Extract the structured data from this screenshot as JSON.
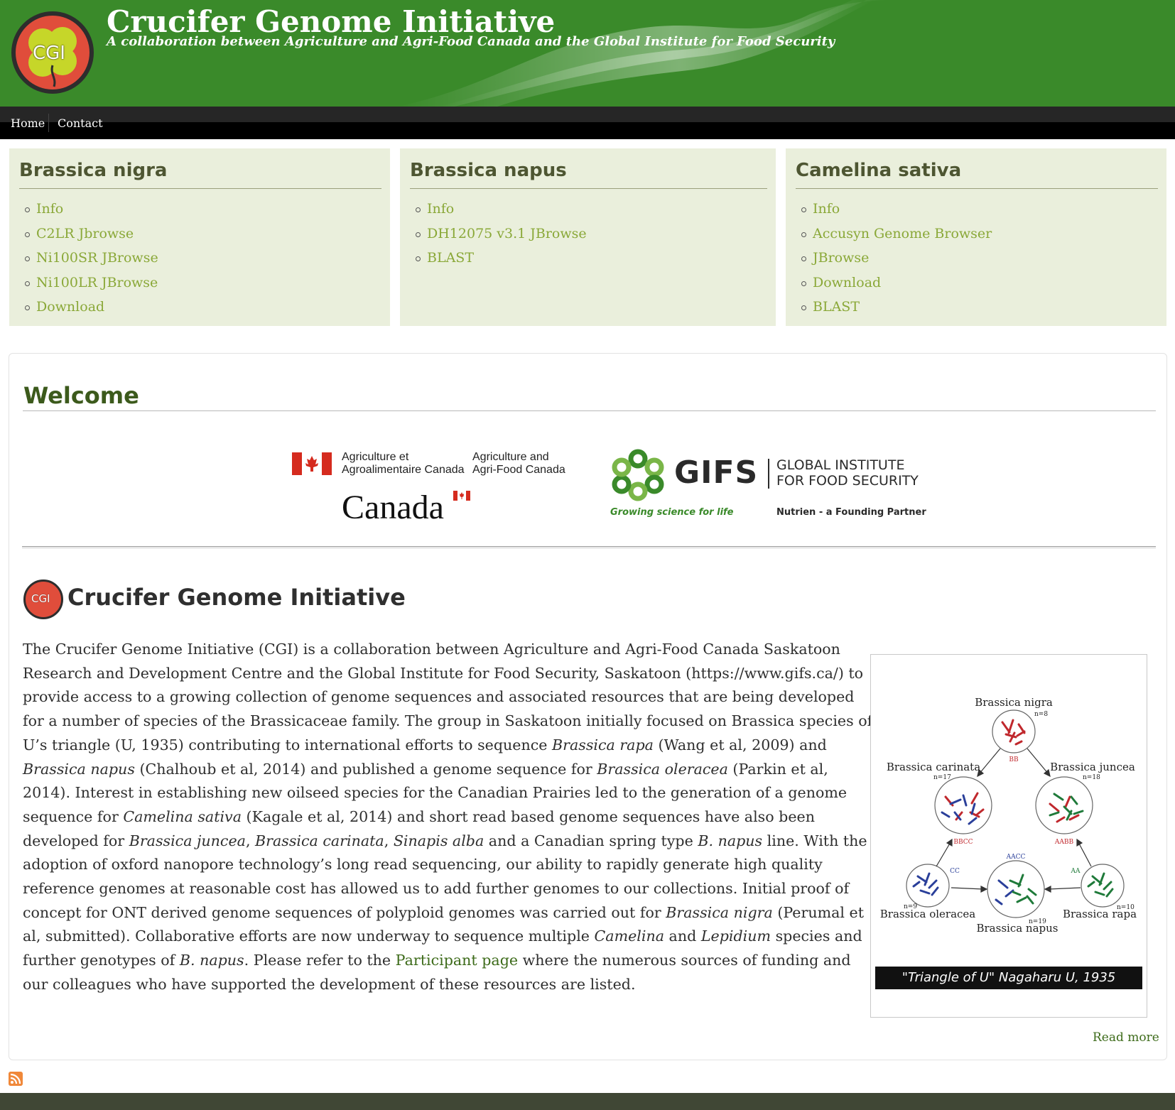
{
  "header": {
    "logo_text": "CGI",
    "title": "Crucifer Genome Initiative",
    "slogan": "A collaboration between Agriculture and Agri-Food Canada and the Global Institute for Food Security"
  },
  "nav": {
    "items": [
      "Home",
      "Contact"
    ]
  },
  "panels": [
    {
      "title": "Brassica nigra",
      "links": [
        "Info",
        "C2LR Jbrowse",
        "Ni100SR JBrowse",
        "Ni100LR JBrowse",
        "Download"
      ]
    },
    {
      "title": "Brassica napus",
      "links": [
        "Info",
        "DH12075 v3.1 JBrowse",
        "BLAST"
      ]
    },
    {
      "title": "Camelina sativa",
      "links": [
        "Info",
        "Accusyn Genome Browser",
        "JBrowse",
        "Download",
        "BLAST"
      ]
    }
  ],
  "welcome": {
    "title": "Welcome",
    "aafc": {
      "fr_line1": "Agriculture et",
      "fr_line2": "Agroalimentaire Canada",
      "en_line1": "Agriculture and",
      "en_line2": "Agri-Food Canada",
      "wordmark": "Canada"
    },
    "gifs": {
      "name": "GIFS",
      "full_line1": "GLOBAL INSTITUTE",
      "full_line2": "FOR FOOD SECURITY",
      "tagline": "Growing science for life",
      "partner": "Nutrien - a Founding Partner"
    }
  },
  "cgi": {
    "logo_text": "CGI",
    "heading": "Crucifer Genome Initiative",
    "body_parts": [
      "The Crucifer Genome Initiative (CGI) is a collaboration between Agriculture and Agri-Food Canada Saskatoon Research and Development Centre and the Global Institute for Food Security, Saskatoon (https://www.gifs.ca/) to provide access to a growing collection of genome sequences and associated resources that are being developed for a number of species of the Brassicaceae family. The group in Saskatoon initially focused on Brassica species of U’s triangle (U, 1935) contributing to international efforts to sequence ",
      "Brassica rapa",
      " (Wang et al, 2009) and ",
      "Brassica napus",
      " (Chalhoub et al, 2014) and published a genome sequence for ",
      "Brassica oleracea",
      " (Parkin et al, 2014). Interest in establishing new oilseed species for the Canadian Prairies led to the generation of a genome sequence for ",
      "Camelina sativa",
      " (Kagale et al, 2014) and short read based genome sequences have also been developed for ",
      "Brassica juncea",
      ", ",
      "Brassica carinata",
      ", ",
      "Sinapis alba",
      " and a Canadian spring type ",
      "B. napus",
      " line. With the adoption of oxford nanopore technology’s long read sequencing, our ability to rapidly generate high quality reference genomes at reasonable cost has allowed us to add further genomes to our collections. Initial proof of concept for ONT derived genome sequences of polyploid genomes was carried out for ",
      "Brassica nigra",
      " (Perumal et al, submitted). Collaborative efforts are now underway to sequence multiple ",
      "Camelina",
      " and ",
      "Lepidium",
      " species and further genotypes of ",
      "B. napus",
      ". Please refer to the ",
      "Participant page",
      " where the numerous sources of funding and our colleagues who have supported the development of these resources are listed."
    ],
    "figure": {
      "caption": "\"Triangle of U\" Nagaharu U, 1935",
      "nodes": [
        {
          "name": "Brassica nigra",
          "n": "n=8",
          "genome": "BB"
        },
        {
          "name": "Brassica carinata",
          "n": "n=17",
          "genome": "BBCC"
        },
        {
          "name": "Brassica juncea",
          "n": "n=18",
          "genome": "AABB"
        },
        {
          "name": "Brassica oleracea",
          "n": "n=9",
          "genome": "CC"
        },
        {
          "name": "Brassica napus",
          "n": "n=19",
          "genome": "AACC"
        },
        {
          "name": "Brassica rapa",
          "n": "n=10",
          "genome": "AA"
        }
      ]
    },
    "read_more": "Read more"
  },
  "colors": {
    "header_green": "#3a8a2a",
    "panel_bg": "#eaefdc",
    "panel_link": "#8aa838",
    "heading_green": "#3c5a1c",
    "footer": "#404735"
  }
}
